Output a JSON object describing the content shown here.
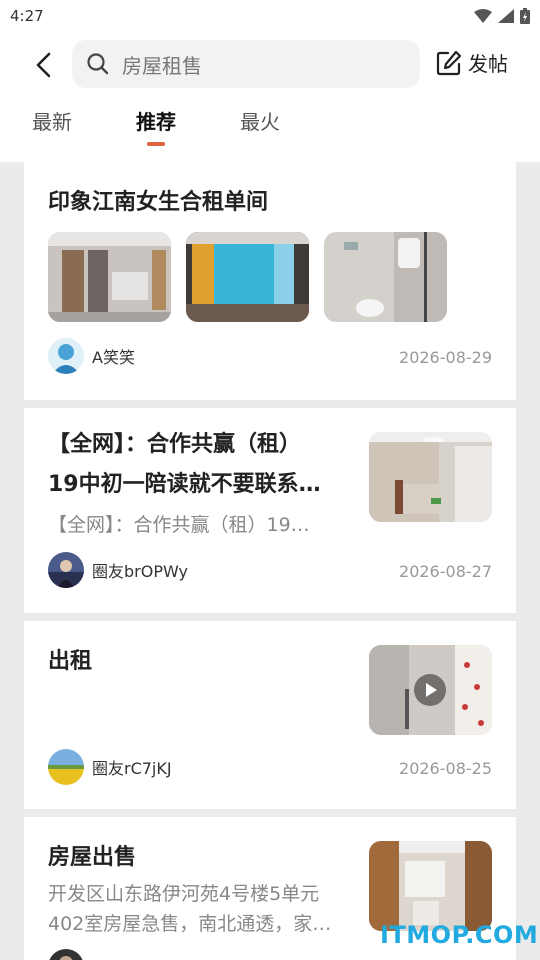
{
  "status": {
    "time": "4:27"
  },
  "search": {
    "placeholder": "房屋租售"
  },
  "toolbar": {
    "post_label": "发帖"
  },
  "tabs": [
    {
      "label": "最新",
      "active": false
    },
    {
      "label": "推荐",
      "active": true
    },
    {
      "label": "最火",
      "active": false
    }
  ],
  "posts": [
    {
      "title": "印象江南女生合租单间",
      "author": "A笑笑",
      "date": "2026-08-29"
    },
    {
      "title_line1": "【全网】：合作共赢（租）",
      "title_line2": "19中初一陪读就不要联系…",
      "summary": "【全网】：合作共赢（租）19…",
      "author": "圈友brOPWy",
      "date": "2026-08-27"
    },
    {
      "title": "出租",
      "author": "圈友rC7jKJ",
      "date": "2026-08-25"
    },
    {
      "title": "房屋出售",
      "summary_line1": "开发区山东路伊河苑4号楼5单元",
      "summary_line2": "402室房屋急售，南北通透，家…"
    }
  ],
  "watermark": "ITMOP.COM",
  "colors": {
    "accent": "#e0623c",
    "watermark": "#22a9e0"
  }
}
